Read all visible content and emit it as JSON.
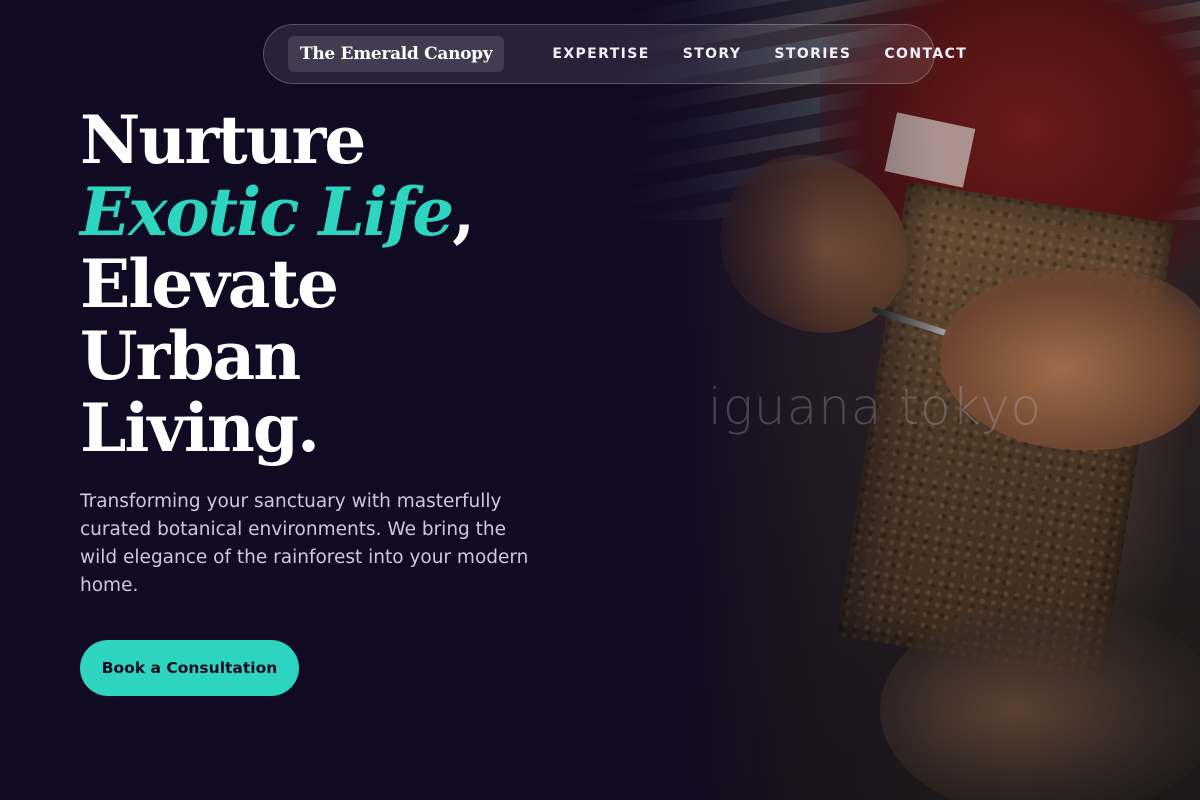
{
  "nav": {
    "brand": "The Emerald Canopy",
    "links": [
      "EXPERTISE",
      "STORY",
      "STORIES",
      "CONTACT"
    ]
  },
  "hero": {
    "line1": "Nurture",
    "accent": "Exotic Life",
    "comma": ",",
    "line3": "Elevate",
    "line4": "Urban",
    "line5": "Living.",
    "subtitle": "Transforming your sanctuary with masterfully curated botanical environments. We bring the wild elegance of the rainforest into your modern home.",
    "cta": "Book a Consultation"
  },
  "image": {
    "watermark": "iguana tokyo"
  },
  "colors": {
    "background": "#100a22",
    "accent": "#2dd4bf",
    "text": "#ffffff",
    "muted": "#cfc8dc"
  }
}
